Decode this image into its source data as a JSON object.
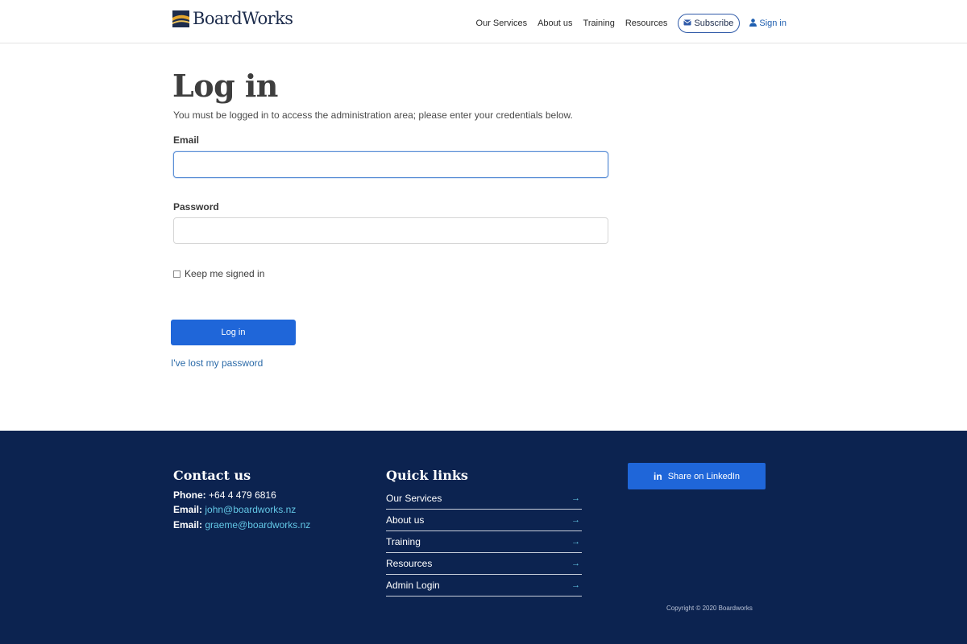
{
  "header": {
    "brand": "BoardWorks",
    "nav": [
      "Our Services",
      "About us",
      "Training",
      "Resources"
    ],
    "subscribe_label": "Subscribe",
    "signin_label": "Sign in"
  },
  "main": {
    "title": "Log in",
    "intro": "You must be logged in to access the administration area; please enter your credentials below.",
    "email_label": "Email",
    "email_value": "",
    "password_label": "Password",
    "password_value": "",
    "remember_label": "Keep me signed in",
    "login_button": "Log in",
    "lost_password": "I've lost my password"
  },
  "footer": {
    "contact_heading": "Contact us",
    "phone_label": "Phone:",
    "phone": "+64 4 479 6816",
    "email_label": "Email:",
    "email1": "john@boardworks.nz",
    "email2": "graeme@boardworks.nz",
    "quick_heading": "Quick links",
    "quick_links": [
      "Our Services",
      "About us",
      "Training",
      "Resources",
      "Admin Login"
    ],
    "linkedin_label": "Share on LinkedIn",
    "copyright": "Copyright © 2020 Boardworks"
  },
  "colors": {
    "accent": "#1f66d9",
    "footer_bg": "#0c2350",
    "link": "#63c7e6"
  }
}
